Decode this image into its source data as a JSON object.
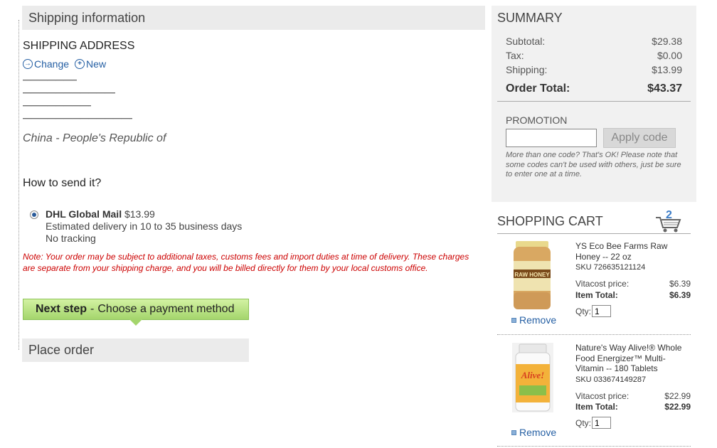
{
  "shipping": {
    "section_title": "Shipping information",
    "address_heading": "SHIPPING ADDRESS",
    "change_label": "Change",
    "new_label": "New",
    "address_country": "China - People's Republic of",
    "how_to_send": "How to send it?",
    "option": {
      "name": "DHL Global Mail",
      "price": "$13.99",
      "delivery": "Estimated delivery in 10 to 35 business days",
      "tracking": "No tracking",
      "selected": true
    },
    "note": "Note: Your order may be subject to additional taxes, customs fees and import duties at time of delivery. These charges are separate from your shipping charge, and you will be billed directly for them by your local customs office.",
    "next_step_bold": "Next step",
    "next_step_dash": "-",
    "next_step_text": "Choose a payment method",
    "place_order_title": "Place order"
  },
  "summary": {
    "title": "SUMMARY",
    "subtotal_label": "Subtotal:",
    "subtotal_value": "$29.38",
    "tax_label": "Tax:",
    "tax_value": "$0.00",
    "shipping_label": "Shipping:",
    "shipping_value": "$13.99",
    "total_label": "Order Total:",
    "total_value": "$43.37",
    "promotion_label": "PROMOTION",
    "promo_value": "",
    "apply_label": "Apply code",
    "promo_note": "More than one code? That's OK! Please note that some codes can't be used with others, just be sure to enter one at a time."
  },
  "cart": {
    "title": "SHOPPING CART",
    "count": "2",
    "items": [
      {
        "name": "YS Eco Bee Farms Raw Honey -- 22 oz",
        "sku": "SKU 726635121124",
        "price_label": "Vitacost price:",
        "price": "$6.39",
        "total_label": "Item Total:",
        "total": "$6.39",
        "qty_label": "Qty:",
        "qty": "1",
        "remove_label": "Remove",
        "image_text": "RAW HONEY"
      },
      {
        "name": "Nature's Way Alive!® Whole Food Energizer™ Multi-Vitamin -- 180 Tablets",
        "sku": "SKU 033674149287",
        "price_label": "Vitacost price:",
        "price": "$22.99",
        "total_label": "Item Total:",
        "total": "$22.99",
        "qty_label": "Qty:",
        "qty": "1",
        "remove_label": "Remove",
        "image_text": "Alive!"
      }
    ]
  },
  "colors": {
    "link": "#2660a4",
    "note_red": "#cc0000",
    "next_green": "#a4d56c",
    "panel_gray": "#f1f1f1"
  }
}
